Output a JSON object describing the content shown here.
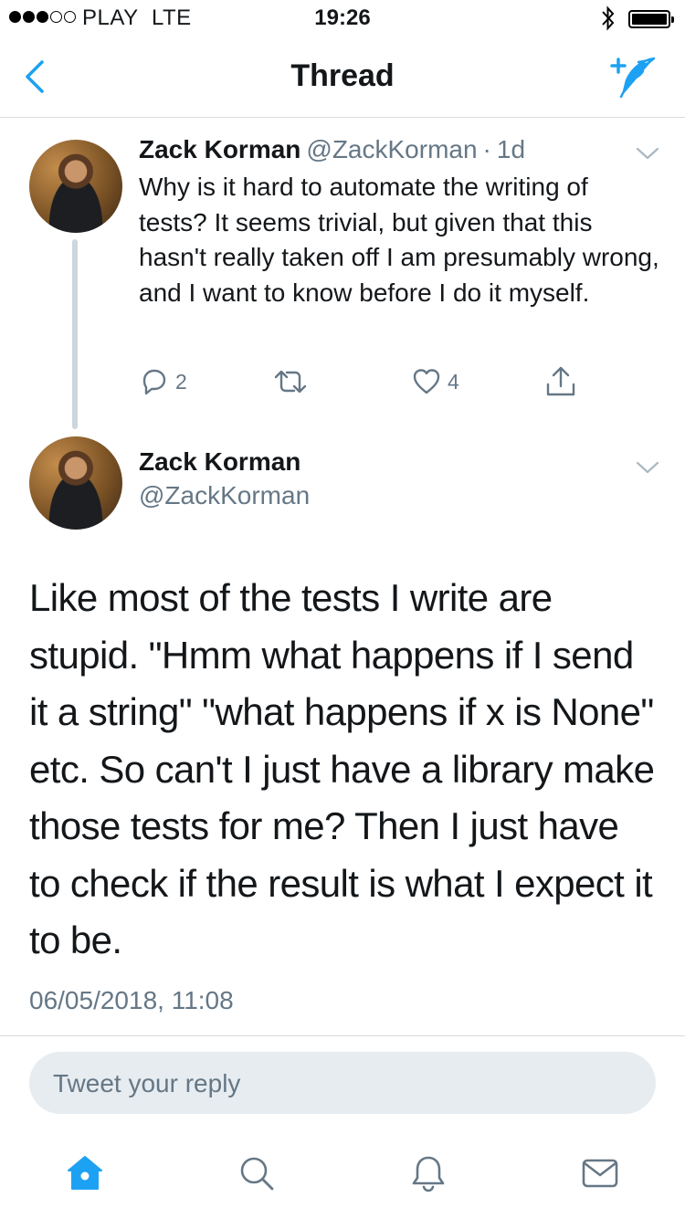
{
  "status_bar": {
    "carrier": "PLAY",
    "network": "LTE",
    "time": "19:26",
    "signal_bars": 3,
    "signal_max": 5,
    "battery_level": 1.0
  },
  "nav": {
    "title": "Thread",
    "back_icon": "chevron-left-icon",
    "compose_icon": "compose-tweet-icon"
  },
  "colors": {
    "accent": "#1da1f2",
    "text": "#14171a",
    "secondary": "#657786",
    "divider": "#d8dde1",
    "input_bg": "#e6ecf0"
  },
  "tweet1": {
    "name": "Zack Korman",
    "handle": "@ZackKorman",
    "time_sep": "·",
    "age": "1d",
    "text": "Why is it hard to automate the writing of tests? It seems trivial, but given that this hasn't really taken off I am presumably wrong, and I want to know before I do it myself.",
    "replies": "2",
    "retweets": "",
    "likes": "4"
  },
  "tweet2": {
    "name": "Zack Korman",
    "handle": "@ZackKorman",
    "text": "Like most of the tests I write are stupid. \"Hmm what happens if I send it a string\" \"what happens if x is None\" etc. So can't I just have a library make those tests for me? Then I just have to check if the result is what I expect it to be.",
    "timestamp": "06/05/2018, 11:08"
  },
  "reply_box": {
    "placeholder": "Tweet your reply"
  },
  "tabbar": {
    "items": [
      "home-icon",
      "search-icon",
      "notifications-icon",
      "messages-icon"
    ],
    "active": "home-icon"
  }
}
